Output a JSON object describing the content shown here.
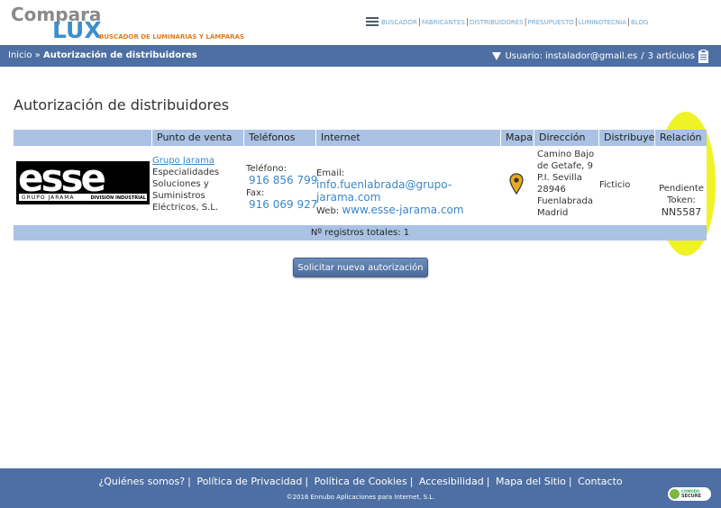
{
  "header": {
    "logo_top": "Compara",
    "logo_bottom": "LUX",
    "logo_tagline": "BUSCADOR DE LUMINARIAS Y LÁMPARAS",
    "nav": [
      "BUSCADOR",
      "FABRICANTES",
      "DISTRIBUIDORES",
      "PRESUPUESTO",
      "LUMINOTECNIA",
      "BLOG"
    ]
  },
  "breadcrumb": {
    "home": "Inicio",
    "separator": "»",
    "current": "Autorización de distribuidores"
  },
  "user": {
    "label": "Usuario: instalador@gmail.es",
    "divider": "/",
    "cart": "3 artículos"
  },
  "page_title": "Autorización de distribuidores",
  "table": {
    "columns": [
      "",
      "Punto de venta",
      "Teléfonos",
      "Internet",
      "Mapa",
      "Dirección",
      "Distribuye",
      "Relación"
    ],
    "rows": [
      {
        "logo": {
          "main": "esse",
          "group": "GRUPO JARAMA",
          "division": "DIVISIÓN INDUSTRIAL"
        },
        "punto_name": "Grupo Jarama",
        "punto_desc": [
          "Especialidades",
          "Soluciones y",
          "Suministros",
          "Eléctricos, S.L."
        ],
        "tel_label": "Teléfono:",
        "tel_value": "916 856 799",
        "fax_label": "Fax:",
        "fax_value": "916 069 927",
        "email_label": "Email:",
        "email_value": "info.fuenlabrada@grupo-jarama.com",
        "web_label": "Web:",
        "web_value": "www.esse-jarama.com",
        "address": [
          "Camino Bajo",
          "de Getafe, 9",
          "P.I. Sevilla",
          "28946",
          "Fuenlabrada",
          "Madrid"
        ],
        "distribuye": "Ficticio",
        "relacion": [
          "Pendiente",
          "Token:",
          "NN5587"
        ]
      }
    ],
    "footer": "Nº registros totales: 1"
  },
  "button_label": "Solicitar nueva autorización",
  "footer": {
    "links": [
      "¿Quiénes somos?",
      "Política de Privacidad",
      "Política de Cookies",
      "Accesibilidad",
      "Mapa del Sitio",
      "Contacto"
    ],
    "copyright": "©2016 Ennubo Aplicaciones para Internet, S.L.",
    "badge_top": "COMODO",
    "badge_bottom": "SECURE"
  },
  "colors": {
    "bar": "#4d6fa3",
    "table_header": "#aac2e3",
    "link": "#3a87c8",
    "highlight": "#eef21a"
  }
}
